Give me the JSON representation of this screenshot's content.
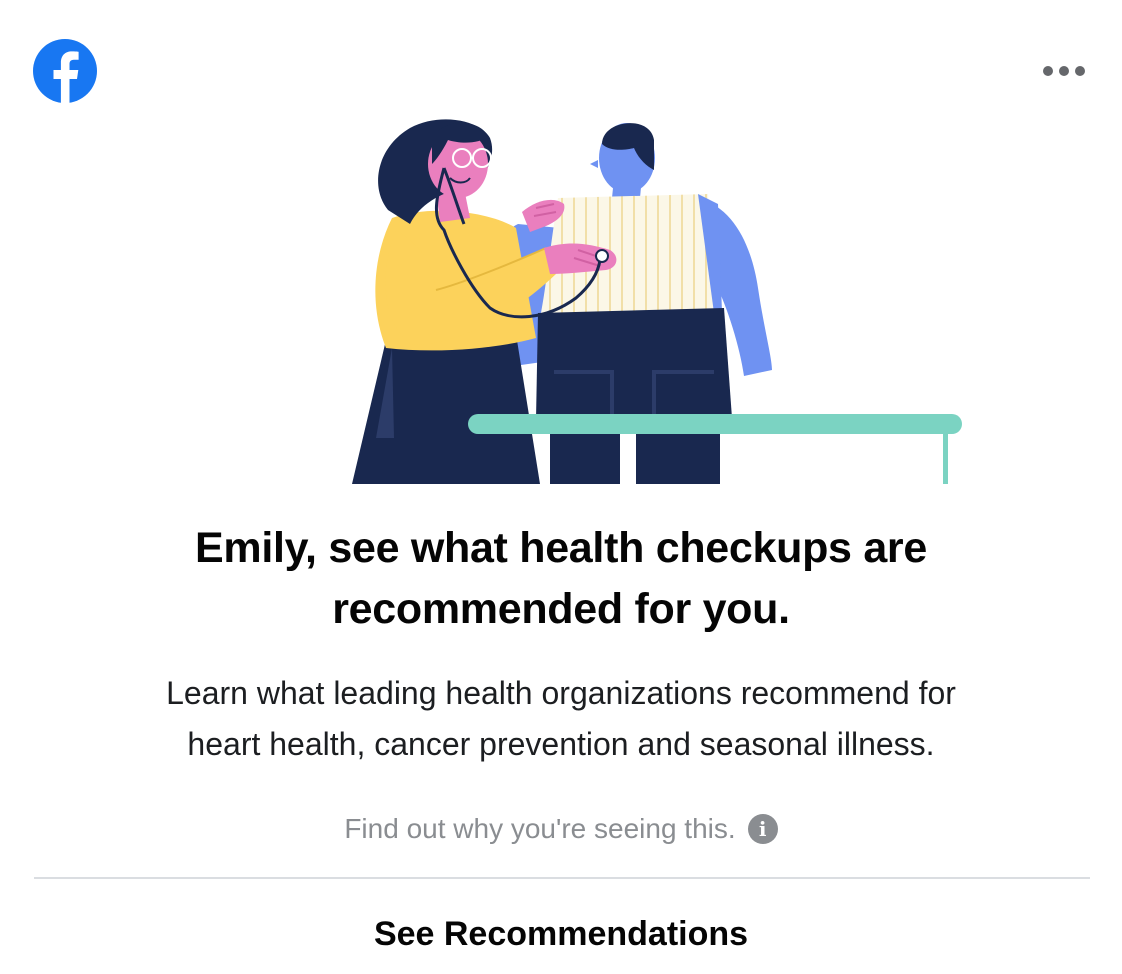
{
  "header": {
    "logo_icon": "facebook-logo-icon",
    "more_icon": "more-options-icon",
    "brand_color": "#1877F2"
  },
  "illustration": {
    "icon": "doctor-checkup-illustration"
  },
  "content": {
    "headline_line1": "Emily, see what health checkups are",
    "headline_line2": "recommended for you.",
    "description_line1": "Learn what leading health organizations recommend for",
    "description_line2": "heart health, cancer prevention and seasonal illness.",
    "why_text": "Find out why you're seeing this.",
    "info_icon_glyph": "i"
  },
  "action": {
    "cta_label": "See Recommendations"
  }
}
